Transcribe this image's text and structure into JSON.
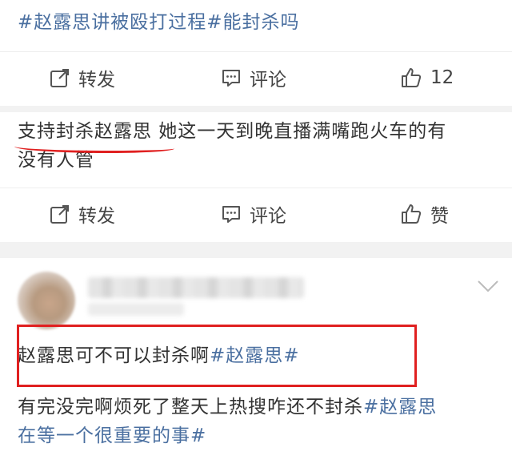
{
  "post1": {
    "hashtag_text": "#赵露思讲被殴打过程#能封杀吗",
    "forward_label": "转发",
    "comment_label": "评论",
    "like_count": "12"
  },
  "post2": {
    "highlighted_text": "支持封杀赵露思",
    "text_rest_line1": " 她这一天到晚直播满嘴跑火车的有",
    "text_line2": "没有人管",
    "forward_label": "转发",
    "comment_label": "评论",
    "like_label": "赞"
  },
  "post3": {
    "boxed_text": "赵露思可不可以封杀啊",
    "boxed_hashtag": "#赵露思#",
    "reply_line1_text": "有完没完啊烦死了整天上热搜咋还不封杀",
    "reply_line1_tag": "#赵露思",
    "reply_line2_tag": "在等一个很重要的事#"
  },
  "colors": {
    "link": "#4a6fa0",
    "highlight_red": "#e02020",
    "background": "#f2f2f2"
  },
  "icons": [
    "share-icon",
    "comment-icon",
    "thumbs-up-icon",
    "chevron-down-icon"
  ]
}
